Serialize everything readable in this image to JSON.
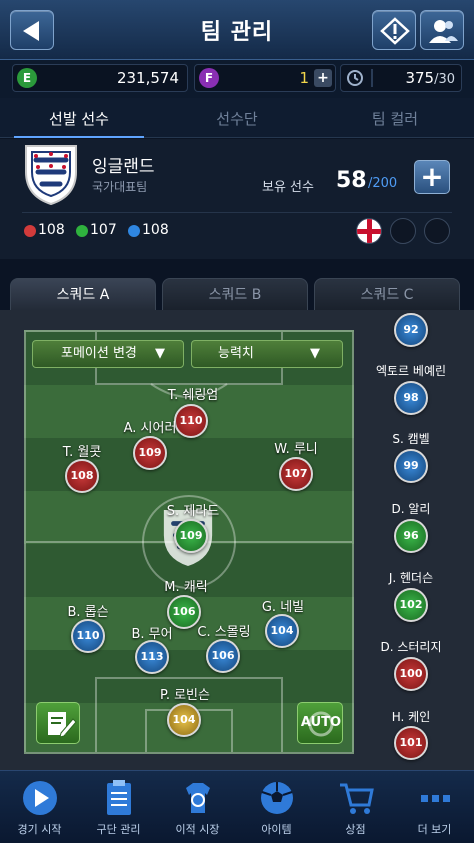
{
  "header": {
    "title": "팀 관리"
  },
  "currency": {
    "e_value": "231,574",
    "f_value": "1",
    "energy": "375",
    "energy_max": "/30"
  },
  "tabs": [
    "선발 선수",
    "선수단",
    "팀 컬러"
  ],
  "team": {
    "name": "잉글랜드",
    "type": "국가대표팀",
    "owned_label": "보유 선수",
    "owned": "58",
    "owned_max": "/200",
    "stat_red": "108",
    "stat_green": "107",
    "stat_blue": "108"
  },
  "squad_tabs": [
    "스쿼드 A",
    "스쿼드 B",
    "스쿼드 C"
  ],
  "pitch": {
    "formation_btn": "포메이션 변경",
    "stat_btn": "능력치",
    "auto_label": "AUTO"
  },
  "players": [
    {
      "name": "T. 쉐링엄",
      "ovr": "110",
      "color": "red"
    },
    {
      "name": "A. 시어러",
      "ovr": "109",
      "color": "red"
    },
    {
      "name": "T. 월콧",
      "ovr": "108",
      "color": "red"
    },
    {
      "name": "W. 루니",
      "ovr": "107",
      "color": "red"
    },
    {
      "name": "S. 제라드",
      "ovr": "109",
      "color": "green"
    },
    {
      "name": "M. 캐릭",
      "ovr": "106",
      "color": "green"
    },
    {
      "name": "B. 롭슨",
      "ovr": "110",
      "color": "blue"
    },
    {
      "name": "B. 무어",
      "ovr": "113",
      "color": "blue"
    },
    {
      "name": "C. 스몰링",
      "ovr": "106",
      "color": "blue"
    },
    {
      "name": "G. 네빌",
      "ovr": "104",
      "color": "blue"
    },
    {
      "name": "P. 로빈슨",
      "ovr": "104",
      "color": "gold"
    }
  ],
  "subs": [
    {
      "name": "",
      "ovr": "92",
      "color": "blue"
    },
    {
      "name": "엑토르 베예린",
      "ovr": "98",
      "color": "blue"
    },
    {
      "name": "S. 캠벨",
      "ovr": "99",
      "color": "blue"
    },
    {
      "name": "D. 알리",
      "ovr": "96",
      "color": "green"
    },
    {
      "name": "J. 헨더슨",
      "ovr": "102",
      "color": "green"
    },
    {
      "name": "D. 스터리지",
      "ovr": "100",
      "color": "red"
    },
    {
      "name": "H. 케인",
      "ovr": "101",
      "color": "red"
    }
  ],
  "nav": [
    "경기 시작",
    "구단 관리",
    "이적 시장",
    "아이템",
    "상점",
    "더 보기"
  ],
  "colors": {
    "red": "#a82424",
    "green": "#2a8f36",
    "blue": "#1f5fa5",
    "gold": "#c49a24",
    "accent": "#5fa4ff"
  },
  "icons": [
    "back-arrow-icon",
    "alert-icon",
    "profile-icon",
    "e-coin-icon",
    "f-coin-icon",
    "plus-icon",
    "clock-icon",
    "three-lions-crest-icon",
    "england-flag-icon",
    "edit-icon",
    "auto-refresh-icon",
    "play-icon",
    "clipboard-icon",
    "transfer-shirt-icon",
    "ball-icon",
    "cart-icon",
    "more-dots-icon"
  ]
}
